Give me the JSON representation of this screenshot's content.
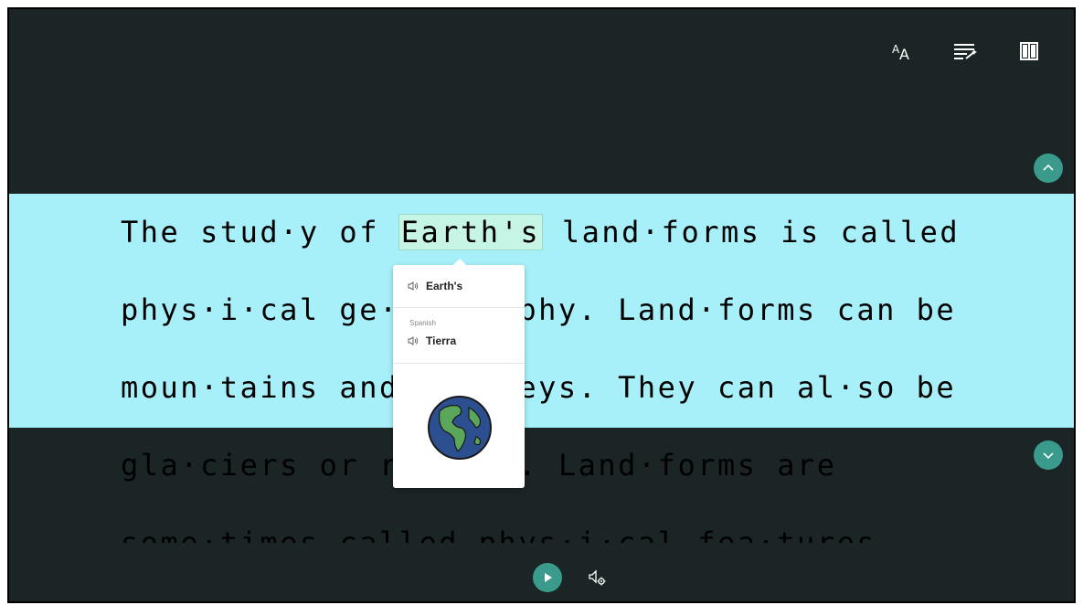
{
  "toolbar": {
    "text_size_icon": "text-size-icon",
    "line_focus_icon": "line-focus-icon",
    "reading_preferences_icon": "book-icon"
  },
  "reader": {
    "lines": [
      {
        "pre": "The stud·y of ",
        "word": "Earth's",
        "post": " land·forms is called"
      },
      {
        "text": "phys·i·cal ge·og·ra·phy. Land·forms can be"
      },
      {
        "text": "moun·tains and val·leys. They can al·so be"
      },
      {
        "text": "gla·ciers or riv·ers. Land·forms are"
      },
      {
        "text": "some·times called phys·i·cal fea·tures."
      }
    ]
  },
  "picture_dictionary": {
    "word": "Earth's",
    "translation_language": "Spanish",
    "translation": "Tierra",
    "image_icon": "globe-icon"
  },
  "playback": {
    "play_icon": "play-icon",
    "voice_settings_icon": "voice-settings-icon"
  },
  "colors": {
    "background": "#1b2526",
    "highlight_band": "#a7f0f9",
    "accent": "#3a9b8c",
    "word_highlight": "#c6f5e6"
  }
}
